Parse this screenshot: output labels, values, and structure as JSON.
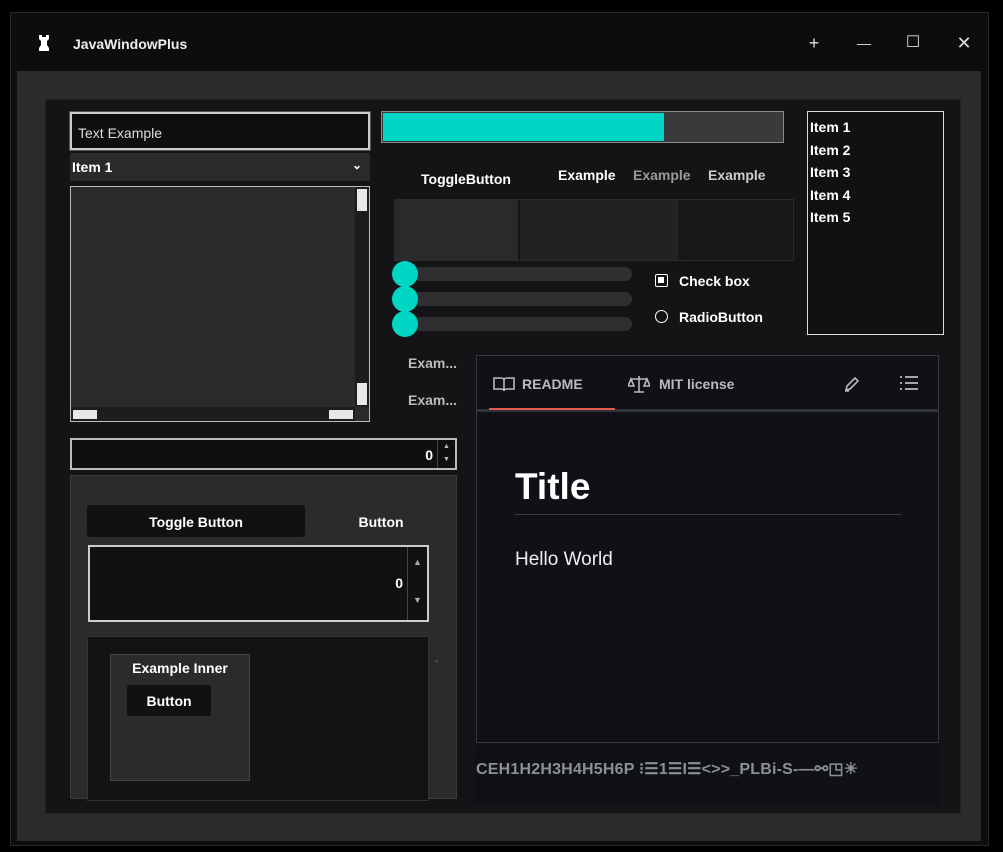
{
  "window": {
    "title": "JavaWindowPlus",
    "controls": {
      "pin": "+",
      "minimize": "—",
      "maximize": "☐",
      "close": "✕"
    }
  },
  "left": {
    "text_field": {
      "value": "Text Example"
    },
    "combo": {
      "selected": "Item 1"
    },
    "spinner": {
      "value": "0"
    }
  },
  "panel": {
    "toggle_button": "Toggle Button",
    "button": "Button",
    "spinner": {
      "value": "0"
    },
    "inner": {
      "title": "Example Inner",
      "button": "Button"
    },
    "dash": "-"
  },
  "progress": {
    "percent": 0.7
  },
  "top_row": {
    "toggle_button": "ToggleButton",
    "labels": [
      "Example",
      "Example",
      "Example"
    ]
  },
  "sliders": [
    0,
    0,
    0
  ],
  "checkbox": {
    "label": "Check box",
    "checked": true
  },
  "radio": {
    "label": "RadioButton",
    "selected": false
  },
  "side_labels": [
    "Exam...",
    "Exam..."
  ],
  "list": {
    "items": [
      "Item 1",
      "Item 2",
      "Item 3",
      "Item 4",
      "Item 5"
    ]
  },
  "markdown": {
    "tabs": [
      {
        "label": "README",
        "icon": "book-icon",
        "active": true
      },
      {
        "label": "MIT license",
        "icon": "scale-icon",
        "active": false
      }
    ],
    "title": "Title",
    "body": "Hello World",
    "toolbar": "CEH1H2H3H4H5H6P ⁝☰1☰I☰<>>_PLBi-S-—⚯◳☀"
  },
  "colors": {
    "accent": "#00d6c4",
    "tab_underline": "#e25b4b",
    "background": "#141416"
  }
}
